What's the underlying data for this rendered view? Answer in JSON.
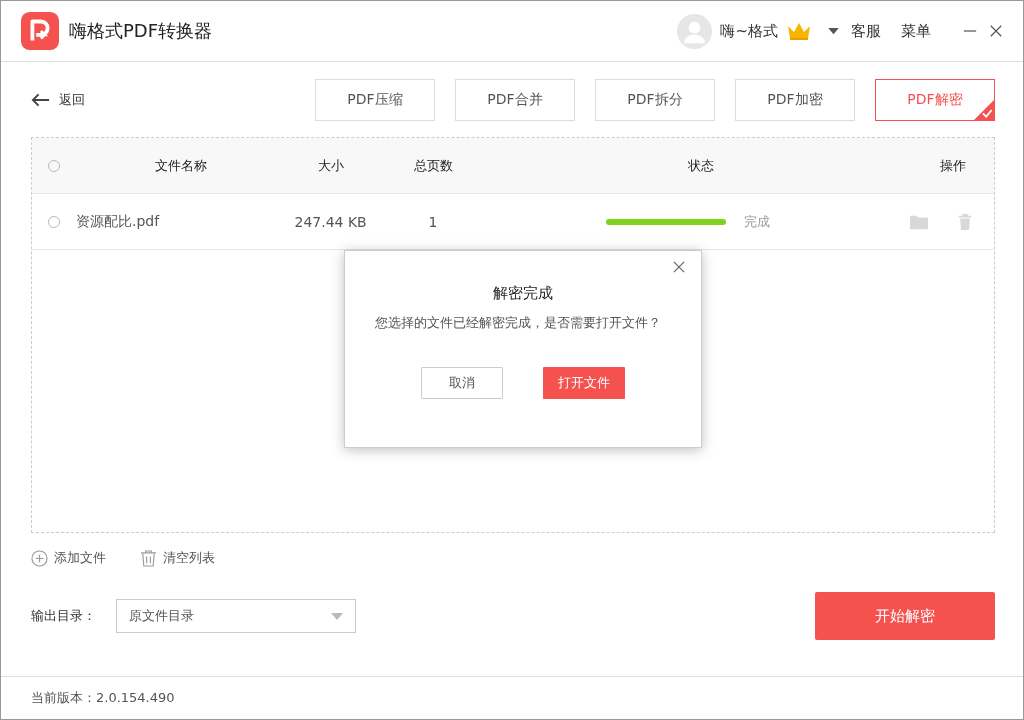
{
  "window": {
    "title": "嗨格式PDF转换器",
    "user": "嗨~格式",
    "links": [
      "客服",
      "菜单"
    ]
  },
  "toolbar": {
    "back": "返回",
    "tabs": [
      {
        "label": "PDF压缩",
        "selected": false
      },
      {
        "label": "PDF合并",
        "selected": false
      },
      {
        "label": "PDF拆分",
        "selected": false
      },
      {
        "label": "PDF加密",
        "selected": false
      },
      {
        "label": "PDF解密",
        "selected": true
      }
    ]
  },
  "table": {
    "select_all_checked": false,
    "columns": [
      "文件名称",
      "大小",
      "总页数",
      "状态",
      "操作"
    ],
    "rows": [
      {
        "name": "资源配比.pdf",
        "size": "247.44 KB",
        "pages": "1",
        "level": 1,
        "status": "完成",
        "checked": false
      }
    ]
  },
  "dialog": {
    "title": "解密完成",
    "message": "您选择的文件已经解密完成，是否需要打开文件？",
    "buttons": [
      {
        "label": "取消",
        "kind": "secondary"
      },
      {
        "label": "打开文件",
        "kind": "primary"
      }
    ]
  },
  "actions": [
    "添加文件",
    "清空列表"
  ],
  "output": {
    "label": "输出目录：",
    "value": "原文件目录"
  },
  "start_button": "开始解密",
  "status_bar": "当前版本：2.0.154.490"
}
